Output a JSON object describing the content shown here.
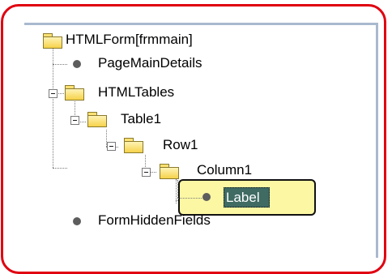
{
  "tree": {
    "nodes": [
      {
        "label": "HTMLForm[frmmain]"
      },
      {
        "label": "PageMainDetails"
      },
      {
        "label": "HTMLTables"
      },
      {
        "label": "Table1"
      },
      {
        "label": "Row1"
      },
      {
        "label": "Column1"
      },
      {
        "label": "Label"
      },
      {
        "label": "FormHiddenFields"
      }
    ]
  },
  "icons": {
    "folder": "folder-icon",
    "bullet": "tree-bullet-icon",
    "expand": "collapse-minus-icon"
  },
  "colors": {
    "frame_border": "#e00010",
    "highlight_box": "#fbf7a3",
    "selected_background": "#3f6b63"
  }
}
